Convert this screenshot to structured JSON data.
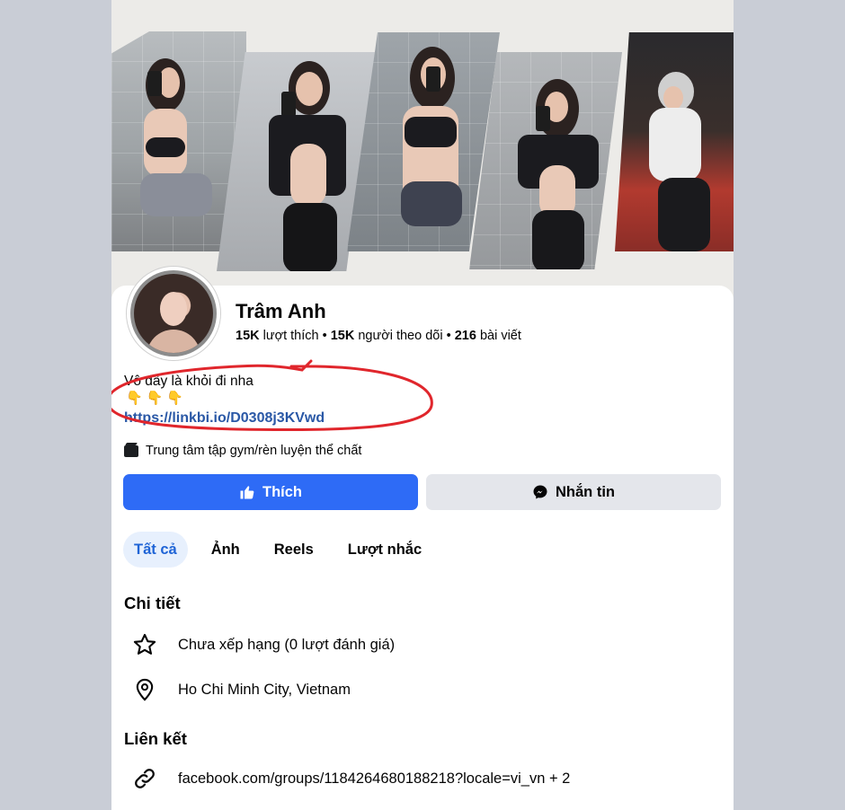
{
  "profile": {
    "name": "Trâm Anh",
    "likes_count": "15K",
    "likes_label": "lượt thích",
    "followers_count": "15K",
    "followers_label": "người theo dõi",
    "posts_count": "216",
    "posts_label": "bài viết",
    "separator": "•",
    "bio_text": "Vô đây là khỏi đi nha",
    "bio_emojis": "👇👇👇",
    "bio_link": "https://linkbi⁠⁠⁠.io/D0308j3KVwd",
    "category": "Trung tâm tập gym/rèn luyện thể chất"
  },
  "actions": {
    "like_label": "Thích",
    "message_label": "Nhắn tin"
  },
  "tabs": [
    {
      "label": "Tất cả",
      "active": true
    },
    {
      "label": "Ảnh",
      "active": false
    },
    {
      "label": "Reels",
      "active": false
    },
    {
      "label": "Lượt nhắc",
      "active": false
    }
  ],
  "details": {
    "title": "Chi tiết",
    "rating": "Chưa xếp hạng (0 lượt đánh giá)",
    "location": "Ho Chi Minh City, Vietnam"
  },
  "links": {
    "title": "Liên kết",
    "url": "facebook.com/groups/1184264680188218?locale=vi_vn + 2"
  },
  "colors": {
    "accent": "#2e6bf6",
    "link": "#2a58a6",
    "annotation": "#e0262c",
    "page_bg": "#c9cdd6"
  }
}
